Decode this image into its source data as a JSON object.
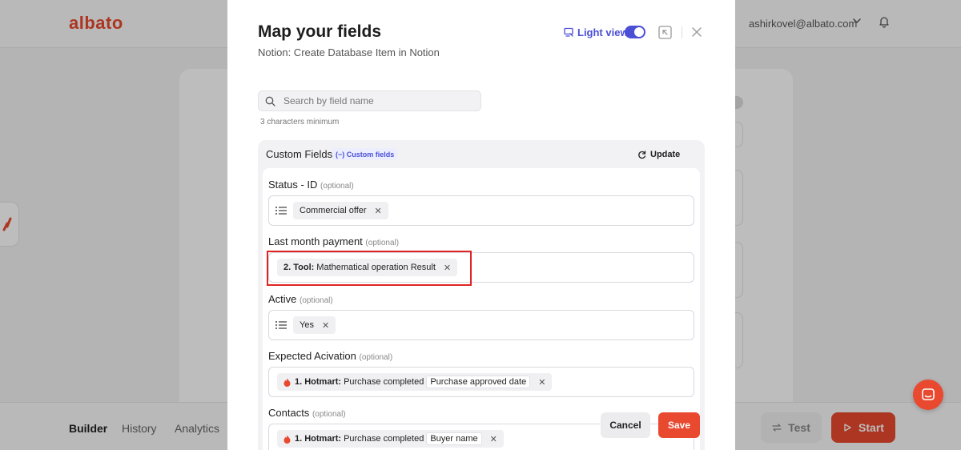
{
  "app": {
    "logo": "albato",
    "user_email": "ashirkovel@albato.com"
  },
  "footer": {
    "tabs": [
      {
        "label": "Builder",
        "active": true
      },
      {
        "label": "History",
        "active": false
      },
      {
        "label": "Analytics",
        "active": false
      }
    ],
    "test_label": "Test",
    "start_label": "Start"
  },
  "modal": {
    "title": "Map your fields",
    "subtitle": "Notion: Create Database Item in Notion",
    "light_view_label": "Light view",
    "light_view_on": true,
    "search": {
      "placeholder": "Search by field name",
      "hint": "3 characters minimum"
    },
    "custom_fields": {
      "title": "Custom Fields",
      "badge": "(−) Custom fields",
      "update_label": "Update"
    },
    "optional_label": "(optional)",
    "fields": [
      {
        "label": "Status - ID",
        "chip_bold": "",
        "chip_text": "Commercial offer",
        "chip_sub": "",
        "has_list_icon": true
      },
      {
        "label": "Last month payment",
        "chip_bold": "2. Tool:",
        "chip_text": "Mathematical operation Result",
        "chip_sub": "",
        "has_list_icon": false
      },
      {
        "label": "Active",
        "chip_bold": "",
        "chip_text": "Yes",
        "chip_sub": "",
        "has_list_icon": true
      },
      {
        "label": "Expected Acivation",
        "chip_bold": "1. Hotmart:",
        "chip_text": "Purchase completed",
        "chip_sub": "Purchase approved date",
        "has_list_icon": false
      },
      {
        "label": "Contacts",
        "chip_bold": "1. Hotmart:",
        "chip_text": "Purchase completed",
        "chip_sub": "Buyer name",
        "has_list_icon": false
      }
    ],
    "cancel_label": "Cancel",
    "save_label": "Save"
  },
  "colors": {
    "brand": "#e8492f",
    "accent": "#4b4fd6",
    "highlight": "#e02424"
  }
}
